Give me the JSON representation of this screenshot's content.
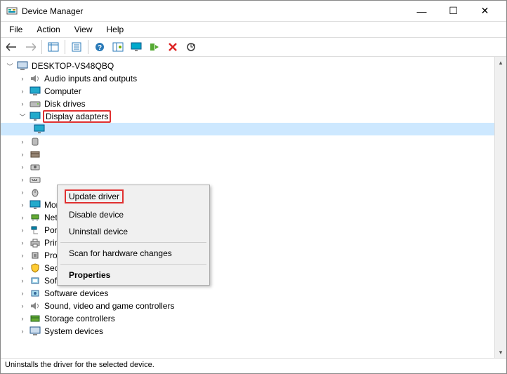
{
  "window": {
    "title": "Device Manager",
    "controls": {
      "minimize": "—",
      "maximize": "☐",
      "close": "✕"
    }
  },
  "menu": {
    "file": "File",
    "action": "Action",
    "view": "View",
    "help": "Help"
  },
  "toolbar": {
    "back": "back-arrow",
    "forward": "forward-arrow",
    "show_hidden": "show-hidden",
    "properties": "properties",
    "help": "help",
    "scan": "scan-hardware",
    "monitor": "display-icon",
    "enable": "enable-device",
    "disable": "disable-device",
    "update": "update-driver"
  },
  "tree": {
    "root": "DESKTOP-VS48QBQ",
    "nodes": [
      {
        "icon": "audio",
        "label": "Audio inputs and outputs"
      },
      {
        "icon": "computer",
        "label": "Computer"
      },
      {
        "icon": "disk",
        "label": "Disk drives"
      },
      {
        "icon": "display",
        "label": "Display adapters",
        "expanded": true,
        "highlighted": true
      },
      {
        "icon": "hid",
        "label": ""
      },
      {
        "icon": "ata",
        "label": ""
      },
      {
        "icon": "imaging",
        "label": ""
      },
      {
        "icon": "keyboard",
        "label": ""
      },
      {
        "icon": "mouse",
        "label": ""
      },
      {
        "icon": "monitor",
        "label": "Monitors"
      },
      {
        "icon": "network",
        "label": "Network adapters"
      },
      {
        "icon": "ports",
        "label": "Ports (COM & LPT)"
      },
      {
        "icon": "printer",
        "label": "Print queues"
      },
      {
        "icon": "cpu",
        "label": "Processors"
      },
      {
        "icon": "security",
        "label": "Security devices"
      },
      {
        "icon": "software",
        "label": "Software components"
      },
      {
        "icon": "software2",
        "label": "Software devices"
      },
      {
        "icon": "sound",
        "label": "Sound, video and game controllers"
      },
      {
        "icon": "storage",
        "label": "Storage controllers"
      },
      {
        "icon": "system",
        "label": "System devices"
      }
    ]
  },
  "context_menu": {
    "update": "Update driver",
    "disable": "Disable device",
    "uninstall": "Uninstall device",
    "scan": "Scan for hardware changes",
    "properties": "Properties"
  },
  "statusbar": {
    "text": "Uninstalls the driver for the selected device."
  }
}
